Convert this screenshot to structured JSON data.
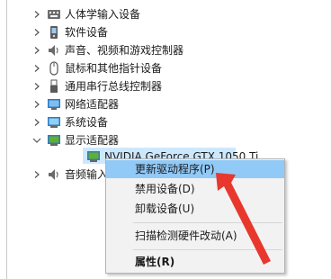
{
  "tree": {
    "items": [
      {
        "label": "人体学输入设备",
        "expanded": false,
        "icon": "hid-icon"
      },
      {
        "label": "软件设备",
        "expanded": false,
        "icon": "software-device-icon"
      },
      {
        "label": "声音、视频和游戏控制器",
        "expanded": false,
        "icon": "speaker-icon"
      },
      {
        "label": "鼠标和其他指针设备",
        "expanded": false,
        "icon": "mouse-icon"
      },
      {
        "label": "通用串行总线控制器",
        "expanded": false,
        "icon": "usb-icon"
      },
      {
        "label": "网络适配器",
        "expanded": false,
        "icon": "network-adapter-icon"
      },
      {
        "label": "系统设备",
        "expanded": false,
        "icon": "system-device-icon"
      },
      {
        "label": "显示适配器",
        "expanded": true,
        "icon": "display-adapter-icon"
      },
      {
        "label": "音频输入和输出",
        "expanded": false,
        "icon": "audio-io-icon"
      }
    ],
    "child": {
      "label": "NVIDIA GeForce GTX 1050 Ti",
      "icon": "gpu-icon"
    }
  },
  "context_menu": {
    "items": [
      {
        "label": "更新驱动程序(P)",
        "highlighted": true
      },
      {
        "label": "禁用设备(D)"
      },
      {
        "label": "卸载设备(U)"
      },
      {
        "label": "扫描检测硬件改动(A)"
      },
      {
        "label": "属性(R)",
        "bold": true
      }
    ]
  },
  "colors": {
    "highlight": "#91c9f7",
    "selection": "#cce8ff",
    "annotation_arrow": "#e8372c"
  }
}
